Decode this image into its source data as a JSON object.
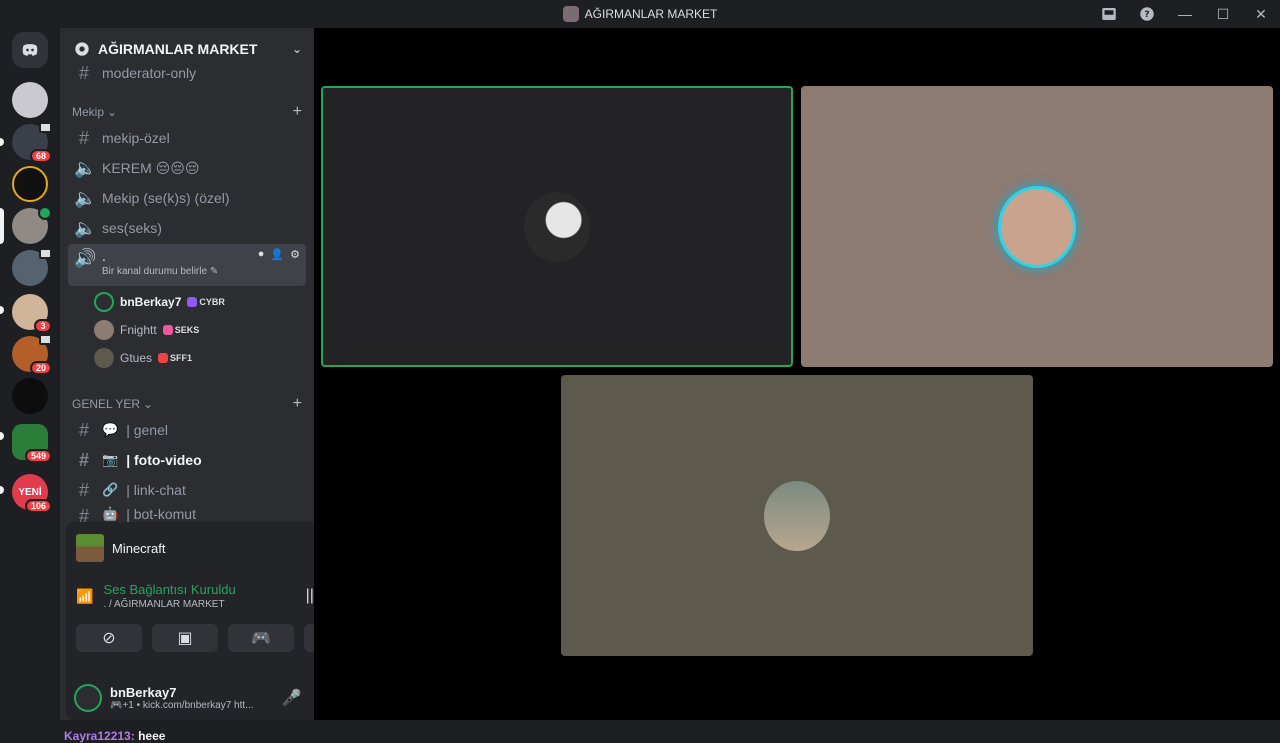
{
  "window": {
    "title": "AĞIRMANLAR MARKET"
  },
  "server_rail": {
    "badges": [
      "68",
      "3",
      "20",
      "549",
      "106"
    ],
    "new_label": "YENİ"
  },
  "server": {
    "name": "AĞIRMANLAR MARKET"
  },
  "channels": {
    "top_channel": "moderator-only",
    "category1": "Mekip",
    "c1": "mekip-özel",
    "c2": "KEREM 😔😔😔",
    "c3": "Mekip (se(k)s) (özel)",
    "c4": "ses(seks)",
    "active_name": ".",
    "active_status": "Bir kanal durumu belirle",
    "category2": "GENEL YER",
    "g1_emoji": "💬",
    "g1": "| genel",
    "g2_emoji": "📷",
    "g2": "| foto-video",
    "g3_emoji": "🔗",
    "g3": "| link-chat",
    "g4_emoji": "🤖",
    "g4": "| bot-komut"
  },
  "voice_users": [
    {
      "name": "bnBerkay7",
      "tag": "CYBR",
      "tag_color": "#8c5cf5"
    },
    {
      "name": "Fnightt",
      "tag": "SEKS",
      "tag_color": "#e85a9c"
    },
    {
      "name": "Gtues",
      "tag": "SFF1",
      "tag_color": "#ef4444"
    }
  ],
  "activity": {
    "game": "Minecraft"
  },
  "voice_status": {
    "status": "Ses Bağlantısı Kuruldu",
    "location": ". / AĞIRMANLAR MARKET"
  },
  "user": {
    "name": "bnBerkay7",
    "status": "🎮+1 • kick.com/bnberkay7 htt..."
  },
  "chat_overlay": {
    "author": "Kayra12213:",
    "message": "heee"
  },
  "colors": {
    "accent_green": "#23a55a",
    "mention_red": "#f23f43",
    "tile2_bg": "#8e7b72",
    "tile3_bg": "#5d594c",
    "tile1_bg": "#232325"
  }
}
